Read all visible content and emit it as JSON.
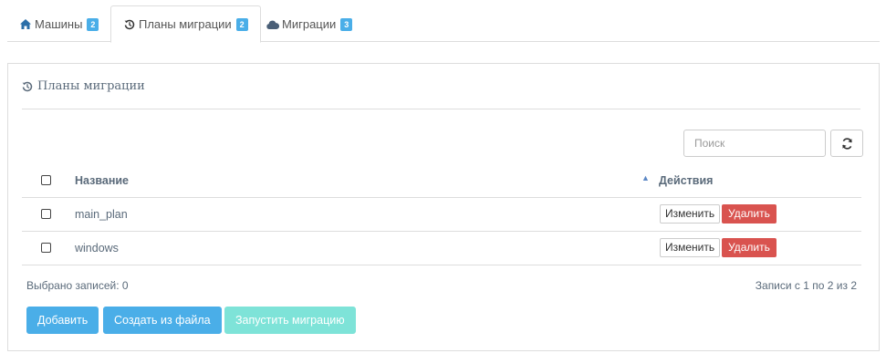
{
  "tabs": [
    {
      "icon": "home-icon",
      "label": "Машины",
      "badge": "2",
      "active": false
    },
    {
      "icon": "history-icon",
      "label": "Планы миграции",
      "badge": "2",
      "active": true
    },
    {
      "icon": "cloud-icon",
      "label": "Миграции",
      "badge": "3",
      "active": false
    }
  ],
  "panel": {
    "title": "Планы миграции",
    "title_icon": "history-icon",
    "search_placeholder": "Поиск",
    "refresh_icon": "refresh-icon"
  },
  "table": {
    "columns": {
      "name": "Название",
      "actions": "Действия"
    },
    "sort_indicator": "▲",
    "rows": [
      {
        "name": "main_plan",
        "edit_label": "Изменить",
        "delete_label": "Удалить"
      },
      {
        "name": "windows",
        "edit_label": "Изменить",
        "delete_label": "Удалить"
      }
    ]
  },
  "footer": {
    "selected": "Выбрано записей: 0",
    "records": "Записи с 1 по 2 из 2"
  },
  "buttons": {
    "add": "Добавить",
    "create_from_file": "Создать из файла",
    "run_migration": "Запустить миграцию"
  },
  "colors": {
    "primary": "#4aaee8",
    "danger": "#d9534f",
    "disabled": "#7ee3d8"
  }
}
